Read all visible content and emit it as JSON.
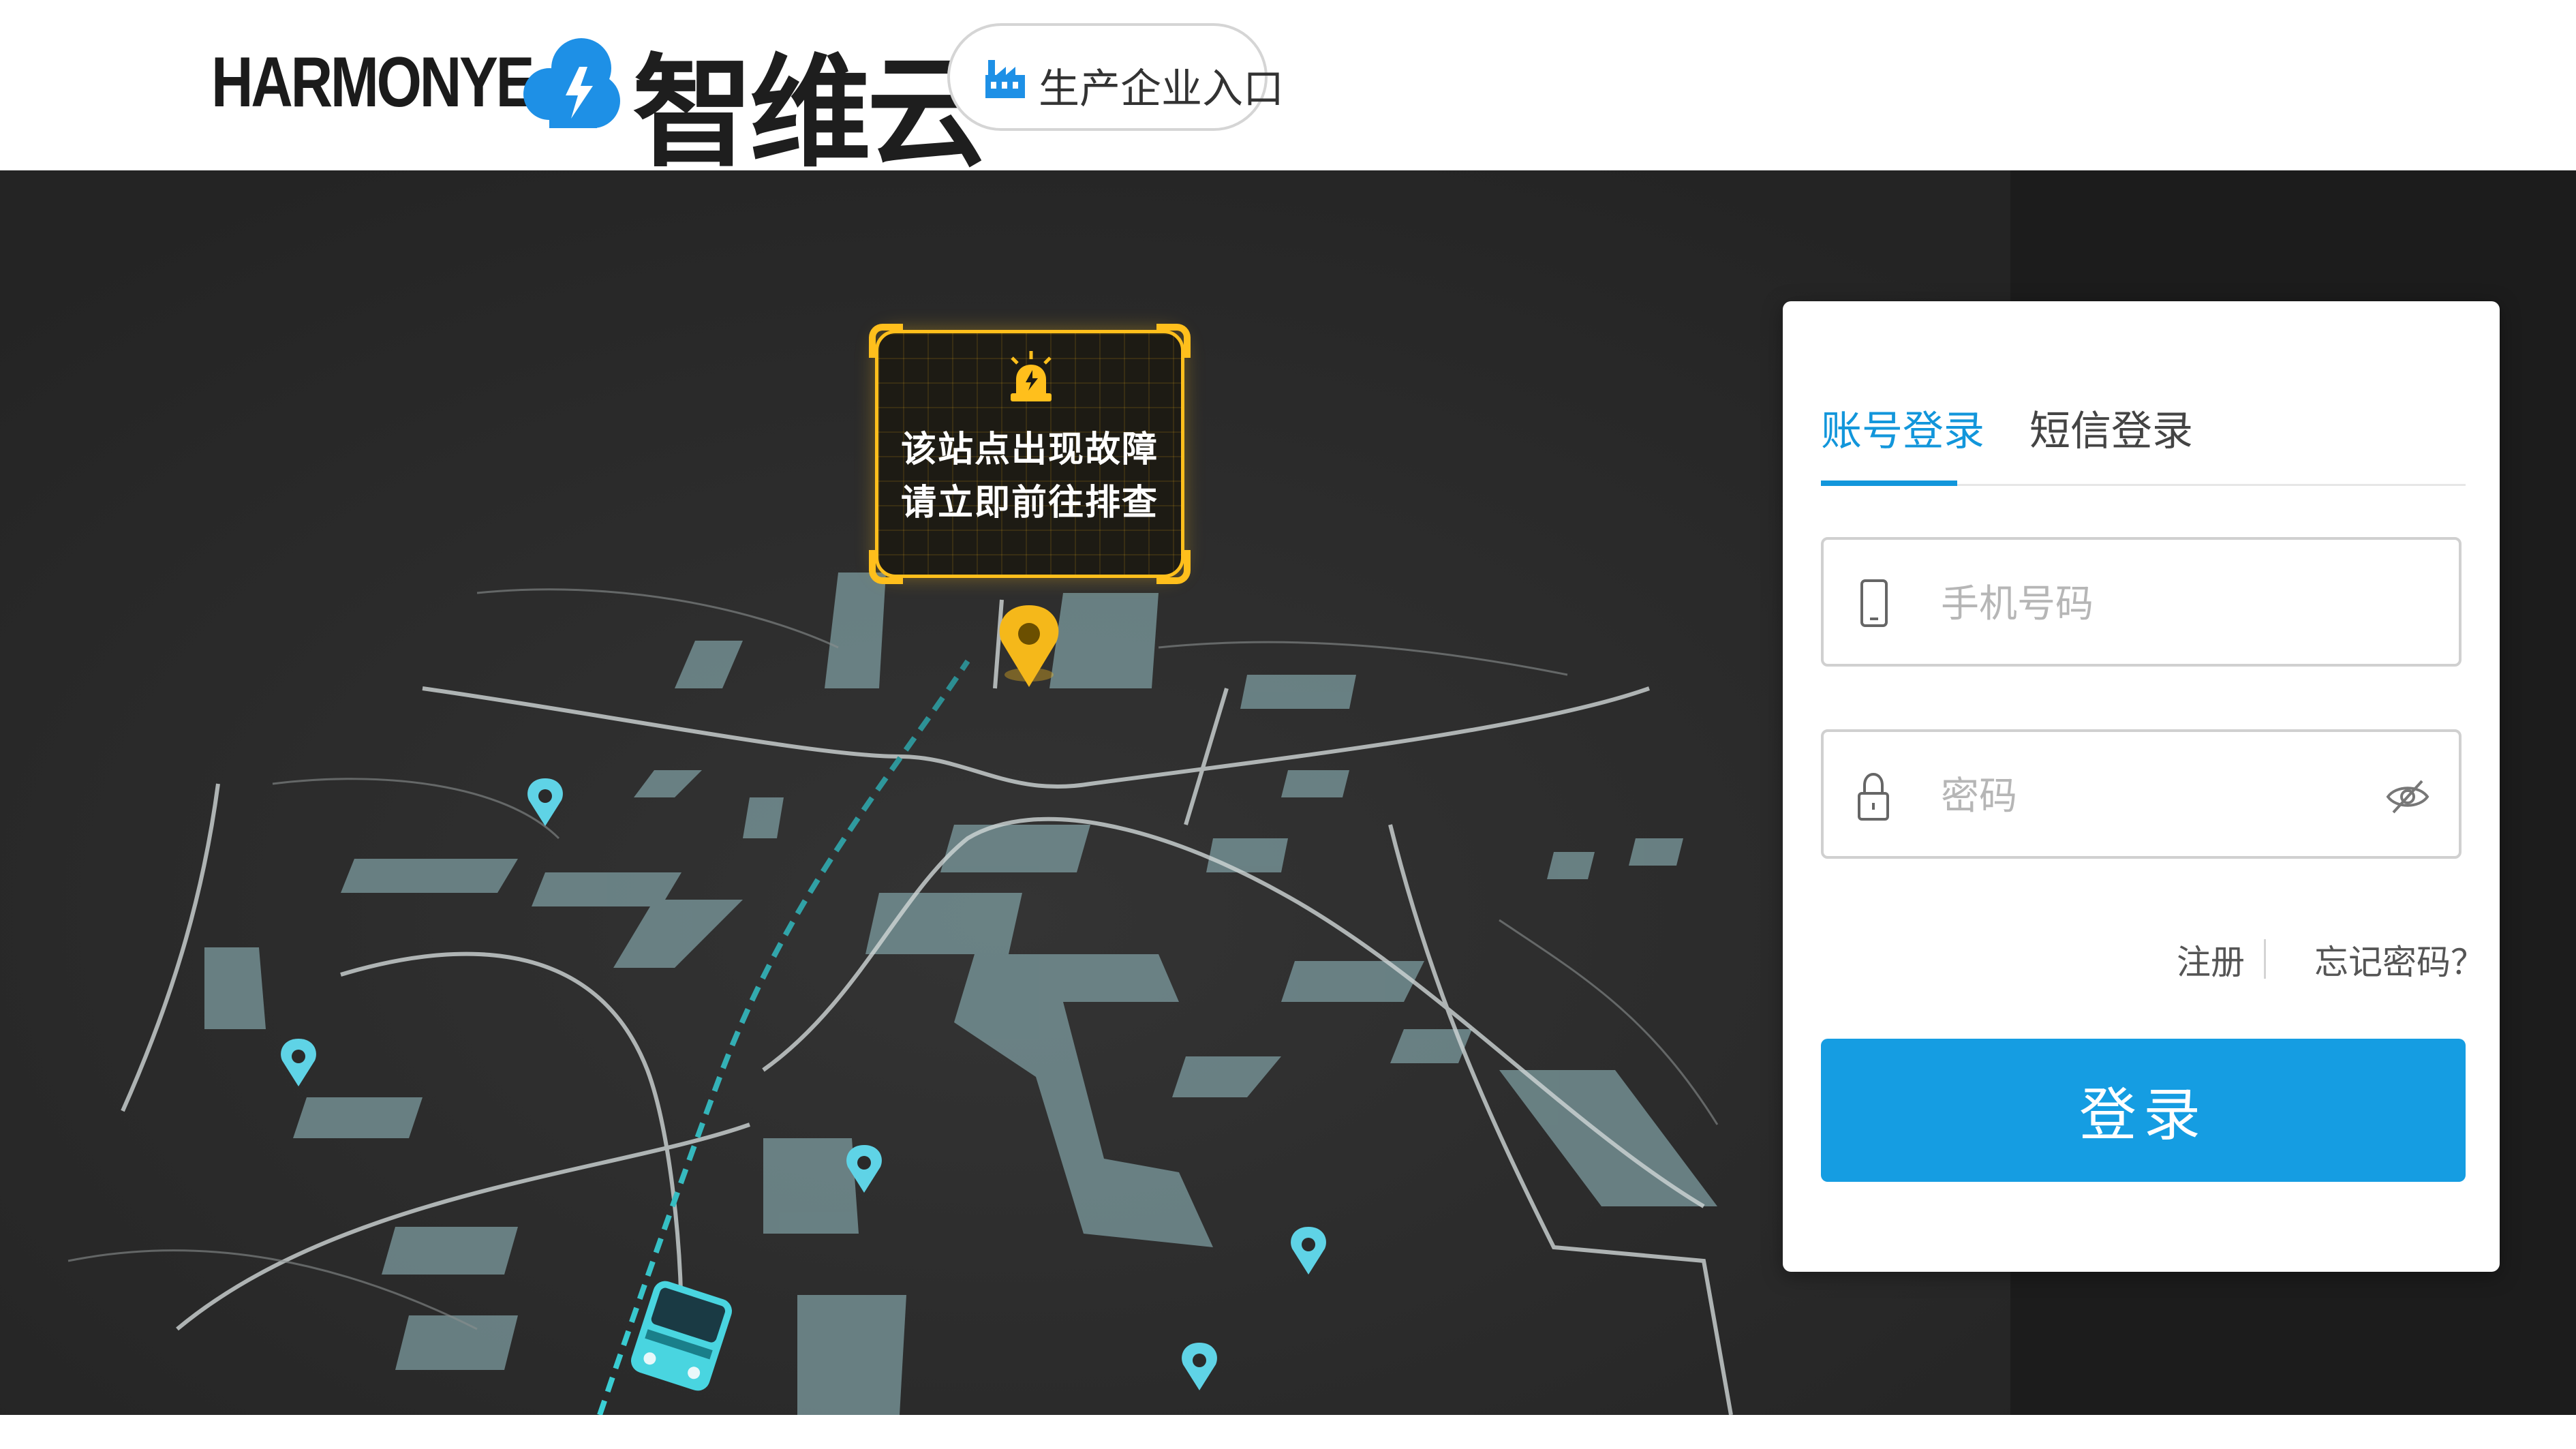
{
  "brand": {
    "name_en": "HARMONYE",
    "name_cn": "智维云",
    "portal_label": "生产企业入口"
  },
  "map": {
    "alert_line1": "该站点出现故障",
    "alert_line2": "请立即前往排查"
  },
  "login": {
    "tabs": [
      {
        "label": "账号登录",
        "active": true
      },
      {
        "label": "短信登录",
        "active": false
      }
    ],
    "phone_placeholder": "手机号码",
    "password_placeholder": "密码",
    "register_label": "注册",
    "forgot_label": "忘记密码？",
    "submit_label": "登录"
  },
  "colors": {
    "accent": "#1296db",
    "alert": "#ffbf1c",
    "marker": "#5fd3e6",
    "map_bg": "#2a2a2a"
  },
  "icons": [
    "cloud-logo-icon",
    "factory-icon",
    "alarm-light-icon",
    "location-pin-icon",
    "bus-icon",
    "phone-icon",
    "lock-icon",
    "eye-off-icon"
  ]
}
